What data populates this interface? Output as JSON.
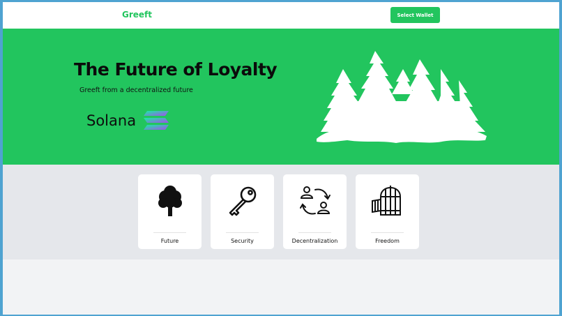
{
  "navbar": {
    "brand": "Greeft",
    "wallet_button_label": "Select Wallet"
  },
  "hero": {
    "title": "The Future of Loyalty",
    "subtitle": "Greeft from a decentralized future",
    "chain_name": "Solana",
    "logo_icon": "solana-logo-icon",
    "illustration": "forest-silhouette"
  },
  "features": [
    {
      "label": "Future",
      "icon": "tree-icon"
    },
    {
      "label": "Security",
      "icon": "key-icon"
    },
    {
      "label": "Decentralization",
      "icon": "people-exchange-icon"
    },
    {
      "label": "Freedom",
      "icon": "open-cage-icon"
    }
  ],
  "colors": {
    "accent": "#22c55e",
    "background": "#f2f3f5",
    "features_band": "#e5e7eb",
    "frame": "#4fa3d1"
  }
}
